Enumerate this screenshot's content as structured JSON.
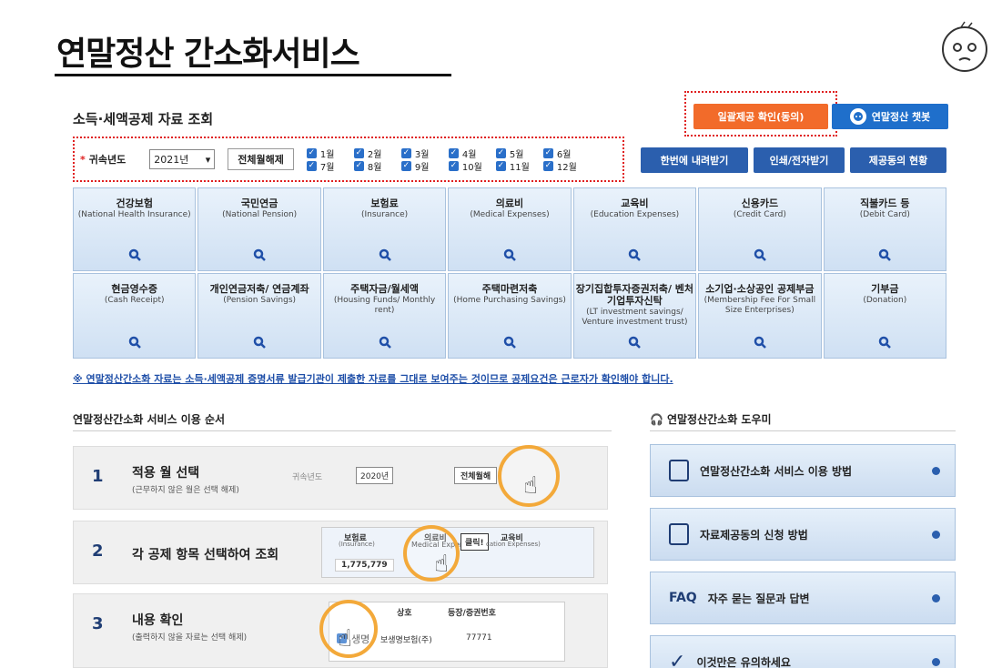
{
  "page_title": "연말정산 간소화서비스",
  "section_title": "소득·세액공제 자료 조회",
  "buttons": {
    "consent": "일괄제공 확인(동의)",
    "chatbot": "연말정산 챗봇",
    "download_all": "한번에 내려받기",
    "print": "인쇄/전자받기",
    "status": "제공동의 현황",
    "toggle_all": "전체월해제"
  },
  "filter": {
    "year_label": "귀속년도",
    "year_value": "2021년",
    "months": [
      "1월",
      "2월",
      "3월",
      "4월",
      "5월",
      "6월",
      "7월",
      "8월",
      "9월",
      "10월",
      "11월",
      "12월"
    ]
  },
  "categories": [
    {
      "title": "건강보험",
      "sub": "(National Health Insurance)"
    },
    {
      "title": "국민연금",
      "sub": "(National Pension)"
    },
    {
      "title": "보험료",
      "sub": "(Insurance)"
    },
    {
      "title": "의료비",
      "sub": "(Medical Expenses)"
    },
    {
      "title": "교육비",
      "sub": "(Education Expenses)"
    },
    {
      "title": "신용카드",
      "sub": "(Credit Card)"
    },
    {
      "title": "직불카드 등",
      "sub": "(Debit Card)"
    },
    {
      "title": "현금영수증",
      "sub": "(Cash Receipt)"
    },
    {
      "title": "개인연금저축/ 연금계좌",
      "sub": "(Pension Savings)"
    },
    {
      "title": "주택자금/월세액",
      "sub": "(Housing Funds/ Monthly rent)"
    },
    {
      "title": "주택마련저축",
      "sub": "(Home Purchasing Savings)"
    },
    {
      "title": "장기집합투자증권저축/ 벤처기업투자신탁",
      "sub": "(LT investment savings/ Venture investment trust)"
    },
    {
      "title": "소기업·소상공인 공제부금",
      "sub": "(Membership Fee For Small Size Enterprises)"
    },
    {
      "title": "기부금",
      "sub": "(Donation)"
    }
  ],
  "notice": "※ 연말정산간소화 자료는 소득·세액공제 증명서류 발급기관이 제출한 자료를 그대로 보여주는 것이므로 공제요건은 근로자가 확인해야 합니다.",
  "steps_title": "연말정산간소화 서비스 이용 순서",
  "steps": [
    {
      "num": "1",
      "title": "적용 월 선택",
      "desc": "(근무하지 않은 월은 선택 해제)"
    },
    {
      "num": "2",
      "title": "각 공제 항목 선택하여 조회",
      "desc": ""
    },
    {
      "num": "3",
      "title": "내용 확인",
      "desc": "(출력하지 않을 자료는 선택 해제)"
    }
  ],
  "step_illustrations": {
    "s1_year_label": "귀속년도",
    "s1_year_value": "2020년",
    "s1_toggle": "전체월해",
    "s2_col1": "보험료",
    "s2_col1_sub": "(Insurance)",
    "s2_value": "1,775,779",
    "s2_col2": "의료비",
    "s2_col2_sub": "Medical Expen",
    "s2_click": "클릭!",
    "s2_col3": "교육비",
    "s2_col3_sub": "cation Expenses)",
    "s3_col1": "상호",
    "s3_col2": "등장/증권번호",
    "s3_row_name": "생명",
    "s3_row_company": "보생명보험(주)",
    "s3_row_num": "77771"
  },
  "helper_title": "연말정산간소화 도우미",
  "helper_items": [
    {
      "label": "연말정산간소화 서비스 이용 방법",
      "icon": "document-pen-icon"
    },
    {
      "label": "자료제공동의 신청 방법",
      "icon": "document-icon"
    },
    {
      "label": "자주 묻는 질문과 답변",
      "icon": "faq-icon",
      "prefix": "FAQ"
    },
    {
      "label": "이것만은 유의하세요",
      "icon": "check-icon"
    }
  ],
  "colors": {
    "accent_blue": "#2b5fae",
    "orange": "#f26b2a",
    "highlight": "#e02020"
  }
}
